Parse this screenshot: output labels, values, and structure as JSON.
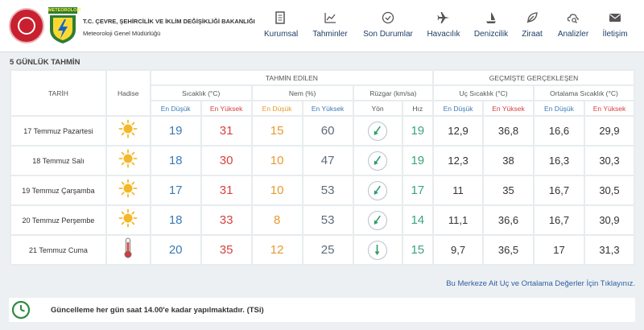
{
  "header": {
    "ministry_title": "T.C. ÇEVRE, ŞEHİRCİLİK VE İKLİM DEĞİŞİKLİĞİ BAKANLIĞI",
    "subtitle": "Meteoroloji Genel Müdürlüğü",
    "mgm_logo_text": "METEOROLOJİ",
    "nav": [
      {
        "label": "Kurumsal",
        "icon": "building-icon"
      },
      {
        "label": "Tahminler",
        "icon": "chart-icon"
      },
      {
        "label": "Son Durumlar",
        "icon": "check-circle-icon"
      },
      {
        "label": "Havacılık",
        "icon": "airplane-icon"
      },
      {
        "label": "Denizcilik",
        "icon": "sailboat-icon"
      },
      {
        "label": "Ziraat",
        "icon": "leaf-icon"
      },
      {
        "label": "Analizler",
        "icon": "cloud-search-icon"
      },
      {
        "label": "İletişim",
        "icon": "envelope-icon"
      }
    ]
  },
  "section_title": "5 GÜNLÜK TAHMİN",
  "table": {
    "col_date": "TARİH",
    "col_event": "Hadise",
    "group_forecast": "TAHMİN EDİLEN",
    "group_past": "GEÇMİŞTE GERÇEKLEŞEN",
    "temp_header": "Sıcaklık (°C)",
    "humidity_header": "Nem (%)",
    "wind_header": "Rüzgar (km/sa)",
    "extreme_header": "Uç Sıcaklık (°C)",
    "avg_header": "Ortalama Sıcaklık (°C)",
    "min_label": "En Düşük",
    "max_label": "En Yüksek",
    "dir_label": "Yön",
    "speed_label": "Hız",
    "rows": [
      {
        "date": "17 Temmuz Pazartesi",
        "event": "sunny-icon",
        "tmin": "19",
        "tmax": "31",
        "hmin": "15",
        "hmax": "60",
        "wind_dir_deg": 215,
        "wind_speed": "19",
        "ext_min": "12,9",
        "ext_max": "36,8",
        "avg_min": "16,6",
        "avg_max": "29,9"
      },
      {
        "date": "18 Temmuz Salı",
        "event": "sunny-icon",
        "tmin": "18",
        "tmax": "30",
        "hmin": "10",
        "hmax": "47",
        "wind_dir_deg": 215,
        "wind_speed": "19",
        "ext_min": "12,3",
        "ext_max": "38",
        "avg_min": "16,3",
        "avg_max": "30,3"
      },
      {
        "date": "19 Temmuz Çarşamba",
        "event": "sunny-icon",
        "tmin": "17",
        "tmax": "31",
        "hmin": "10",
        "hmax": "53",
        "wind_dir_deg": 215,
        "wind_speed": "17",
        "ext_min": "11",
        "ext_max": "35",
        "avg_min": "16,7",
        "avg_max": "30,5"
      },
      {
        "date": "20 Temmuz Perşembe",
        "event": "sunny-icon",
        "tmin": "18",
        "tmax": "33",
        "hmin": "8",
        "hmax": "53",
        "wind_dir_deg": 215,
        "wind_speed": "14",
        "ext_min": "11,1",
        "ext_max": "36,6",
        "avg_min": "16,7",
        "avg_max": "30,9"
      },
      {
        "date": "21 Temmuz Cuma",
        "event": "thermometer-hot-icon",
        "tmin": "20",
        "tmax": "35",
        "hmin": "12",
        "hmax": "25",
        "wind_dir_deg": 180,
        "wind_speed": "15",
        "ext_min": "9,7",
        "ext_max": "36,5",
        "avg_min": "17",
        "avg_max": "31,3"
      }
    ]
  },
  "link_text": "Bu Merkeze Ait Uç ve Ortalama Değerler İçin Tıklayınız.",
  "footer_text": "Güncelleme her gün saat 14.00'e kadar yapılmaktadır. (TSi)",
  "colors": {
    "nav_text": "#1d3f66",
    "min_color": "#3a7ab7",
    "max_color": "#d6423f",
    "humidity_min": "#e69a2e",
    "wind_speed": "#3aa57b",
    "wind_arrow": "#2e9b6a",
    "sun": "#f5b72a"
  }
}
